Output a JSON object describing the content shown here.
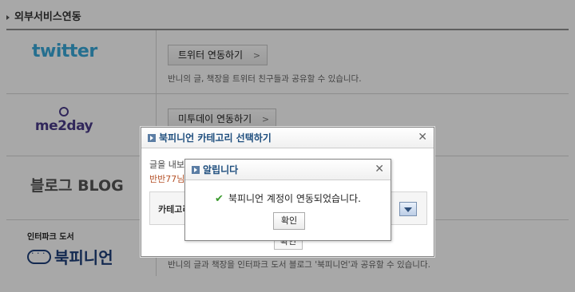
{
  "section": {
    "title": "외부서비스연동"
  },
  "services": [
    {
      "logo": "twitter",
      "button": "트위터 연동하기",
      "desc": "반니의 글, 책장을 트위터 친구들과 공유할 수 있습니다."
    },
    {
      "logo": "me2day",
      "button": "미투데이 연동하기",
      "desc": ""
    },
    {
      "logo_text": "블로그",
      "logo_text2": "BLOG"
    },
    {
      "logo_small": "인터파크 도서",
      "logo_big": "북피니언",
      "desc": "반니의 글과 책장을 인터파크 도서 블로그 '북피니언'과 공유할 수 있습니다."
    }
  ],
  "category_dialog": {
    "title": "북피니언 카테고리 선택하기",
    "message": "글을 내보",
    "user": "반반77님의",
    "category_label": "카테고리",
    "confirm": "확인"
  },
  "alert_dialog": {
    "title": "알립니다",
    "message": "북피니언 계정이 연동되었습니다.",
    "ok": "확인"
  },
  "colors": {
    "overlay": "#000000",
    "accent": "#1e4e7e",
    "check": "#3a9a2c"
  }
}
